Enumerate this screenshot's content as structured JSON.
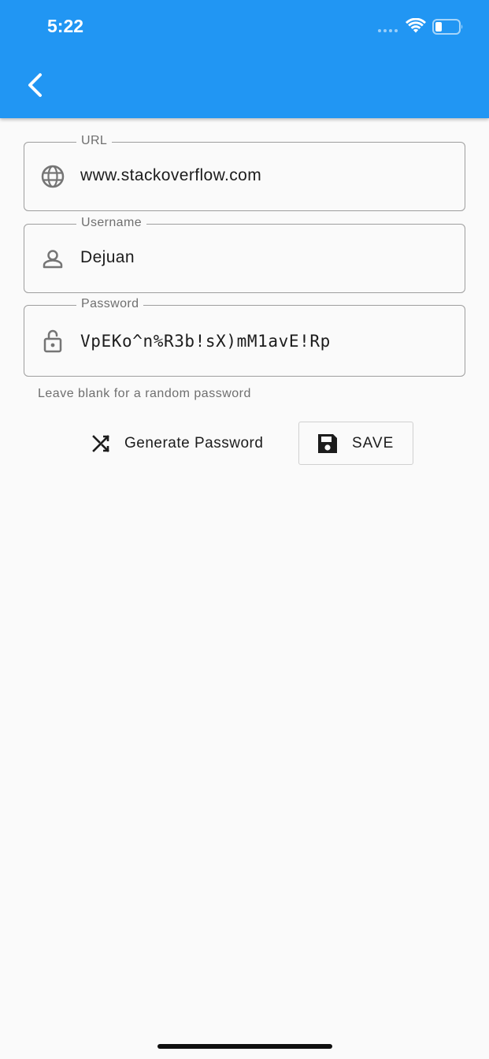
{
  "status_bar": {
    "time": "5:22"
  },
  "app_bar": {
    "back_icon": "chevron-left-icon",
    "color": "#2196f3"
  },
  "form": {
    "url": {
      "label": "URL",
      "value": "www.stackoverflow.com",
      "icon": "globe-icon"
    },
    "username": {
      "label": "Username",
      "value": "Dejuan",
      "icon": "person-icon"
    },
    "password": {
      "label": "Password",
      "value": "VpEKo^n%R3b!sX)mM1avE!Rp",
      "icon": "lock-open-icon"
    },
    "helper_text": "Leave blank for a random password"
  },
  "actions": {
    "generate": {
      "label": "Generate Password",
      "icon": "shuffle-icon"
    },
    "save": {
      "label": "SAVE",
      "icon": "floppy-disk-icon"
    }
  }
}
